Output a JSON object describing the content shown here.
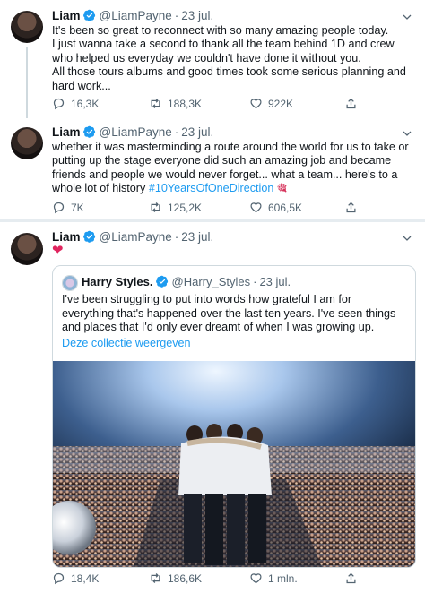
{
  "tweets": [
    {
      "name": "Liam",
      "handle": "@LiamPayne",
      "dot": "·",
      "date": "23 jul.",
      "lines": [
        "It's been so great to reconnect with so many amazing people today.",
        "I just wanna take a second to thank all the team behind 1D and crew",
        "who helped us everyday we couldn't have done it without you.",
        "All those tours albums and good times took some serious planning and",
        "hard work..."
      ],
      "replies": "16,3K",
      "retweets": "188,3K",
      "likes": "922K"
    },
    {
      "name": "Liam",
      "handle": "@LiamPayne",
      "dot": "·",
      "date": "23 jul.",
      "lines": [
        "whether it was masterminding a route around the world for us to take or",
        "putting up the stage everyone did such an amazing job and became",
        "friends and people we would never forget... what a team... here's to a"
      ],
      "last_line_prefix": "whole lot of history ",
      "hashtag": "#10YearsOfOneDirection",
      "emoji": "🎕",
      "replies": "7K",
      "retweets": "125,2K",
      "likes": "606,5K"
    },
    {
      "name": "Liam",
      "handle": "@LiamPayne",
      "dot": "·",
      "date": "23 jul.",
      "heart": "❤",
      "replies": "18,4K",
      "retweets": "186,6K",
      "likes": "1 mln."
    }
  ],
  "quote": {
    "name": "Harry Styles.",
    "handle": "@Harry_Styles",
    "dot": "·",
    "date": "23 jul.",
    "lines": [
      "I've been struggling to put into words how grateful I am for",
      "everything that's happened over the last ten years. I've seen things",
      "and places that I'd only ever dreamt of when I was growing up."
    ],
    "link": "Deze collectie weergeven"
  },
  "icons": {
    "verified": "verified-badge-icon",
    "reply": "reply-icon",
    "retweet": "retweet-icon",
    "like": "like-icon",
    "share": "share-icon",
    "more": "chevron-down-icon"
  },
  "colors": {
    "accent": "#1d9bf0",
    "text": "#0f1419",
    "muted": "#536471",
    "heart": "#e0245e"
  }
}
